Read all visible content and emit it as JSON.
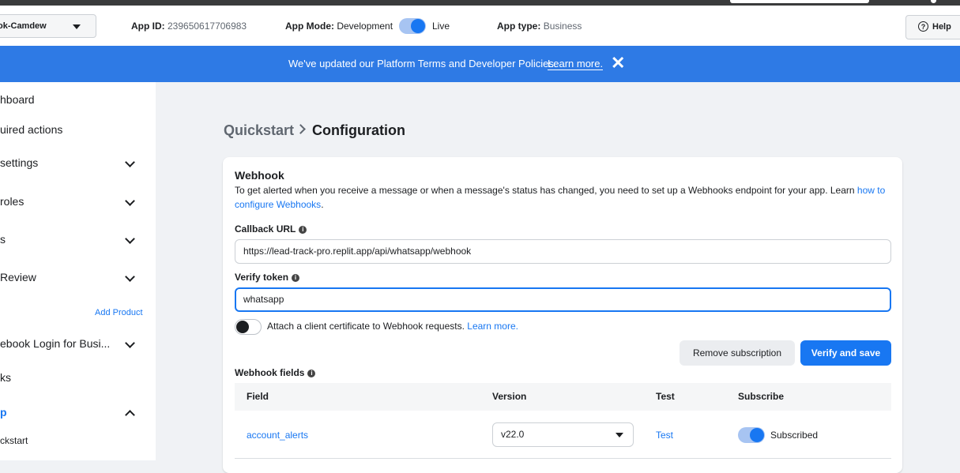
{
  "header": {
    "app_name": "ok-Camdew",
    "app_id_label": "App ID:",
    "app_id": "239650617706983",
    "app_mode_label": "App Mode:",
    "app_mode_dev": "Development",
    "app_mode_live": "Live",
    "app_mode_live_on": true,
    "app_type_label": "App type:",
    "app_type": "Business",
    "help": "Help"
  },
  "banner": {
    "message": "We've updated our Platform Terms and Developer Policies.",
    "link": "Learn more."
  },
  "sidebar": {
    "items": [
      {
        "label": "hboard",
        "chevron": false
      },
      {
        "label": "uired actions",
        "chevron": false
      },
      {
        "label": "settings",
        "chevron": "down"
      },
      {
        "label": "roles",
        "chevron": "down"
      },
      {
        "label": "s",
        "chevron": "down"
      },
      {
        "label": "Review",
        "chevron": "down"
      }
    ],
    "add_product": "Add Product",
    "products": [
      {
        "label": "ebook Login for Busi...",
        "chevron": "down"
      },
      {
        "label": "ks",
        "chevron": false
      },
      {
        "label": "p",
        "chevron": "up",
        "active": true
      },
      {
        "label": "ckstart",
        "chevron": false
      }
    ]
  },
  "breadcrumb": {
    "parent": "Quickstart",
    "current": "Configuration"
  },
  "webhook": {
    "title": "Webhook",
    "description": "To get alerted when you receive a message or when a message's status has changed, you need to set up a Webhooks endpoint for your app. Learn",
    "description_link": "how to configure Webhooks",
    "callback_label": "Callback URL",
    "callback_value": "https://lead-track-pro.replit.app/api/whatsapp/webhook",
    "verify_label": "Verify token",
    "verify_value": "whatsapp",
    "cert_text": "Attach a client certificate to Webhook requests.",
    "cert_link": "Learn more.",
    "cert_enabled": false,
    "remove_button": "Remove subscription",
    "verify_button": "Verify and save"
  },
  "webhook_fields": {
    "title": "Webhook fields",
    "columns": [
      "Field",
      "Version",
      "Test",
      "Subscribe"
    ],
    "rows": [
      {
        "field": "account_alerts",
        "version": "v22.0",
        "test": "Test",
        "subscribe": "Subscribed",
        "subscribed": true
      }
    ]
  },
  "colors": {
    "accent": "#1877f2",
    "banner": "#2e7ae5",
    "background": "#f0f2f5"
  }
}
